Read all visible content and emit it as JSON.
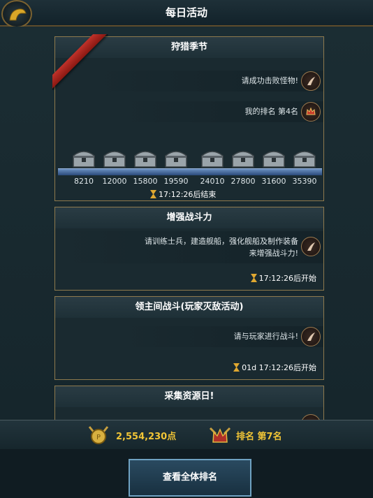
{
  "header": {
    "title": "每日活动"
  },
  "events": [
    {
      "title": "狩猎季节",
      "task": "请成功击败怪物!",
      "rank_text": "我的排名 第4名",
      "milestones": [
        "8210",
        "12000",
        "15800",
        "19590",
        "24010",
        "27800",
        "31600",
        "35390"
      ],
      "timer": "17:12:26后结束"
    },
    {
      "title": "增强战斗力",
      "task_line1": "请训练士兵，建造舰船，强化舰船及制作装备",
      "task_line2": "来增强战斗力!",
      "timer": "17:12:26后开始"
    },
    {
      "title": "领主间战斗(玩家灭敌活动)",
      "task": "请与玩家进行战斗!",
      "timer": "01d 17:12:26后开始"
    },
    {
      "title": "采集资源日!"
    }
  ],
  "summary": {
    "points": "2,554,230点",
    "rank": "排名 第7名"
  },
  "footer": {
    "view_all_label": "查看全体排名"
  },
  "colors": {
    "gold": "#f2c536",
    "border": "#8e7a4e",
    "accent_blue": "#6fa2c2"
  }
}
